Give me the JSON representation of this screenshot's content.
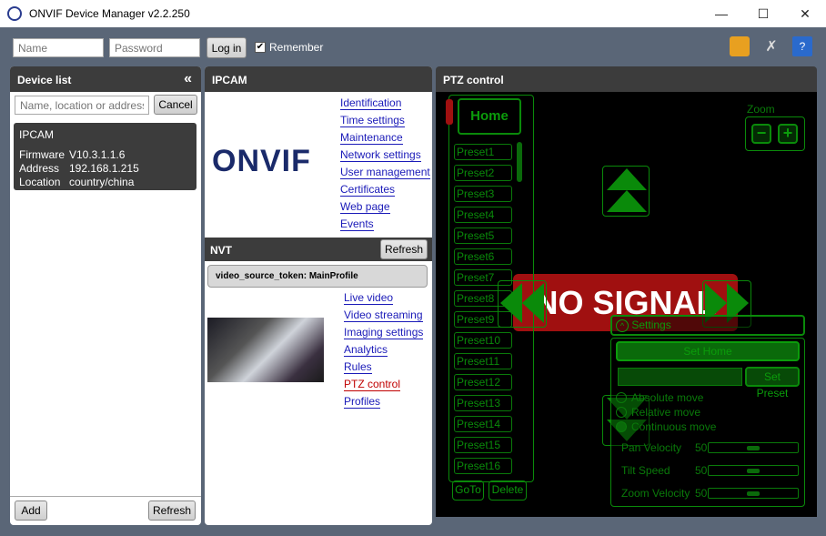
{
  "window": {
    "title": "ONVIF Device Manager v2.2.250",
    "minimize": "—",
    "maximize": "☐",
    "close": "✕"
  },
  "login": {
    "name_placeholder": "Name",
    "password_placeholder": "Password",
    "login_label": "Log in",
    "remember_label": "Remember",
    "remember_checked": true
  },
  "device_list": {
    "title": "Device list",
    "collapse": "«",
    "search_placeholder": "Name, location or address",
    "cancel_label": "Cancel",
    "device": {
      "name": "IPCAM",
      "fields": [
        {
          "k": "Firmware",
          "v": "V10.3.1.1.6"
        },
        {
          "k": "Address",
          "v": "192.168.1.215"
        },
        {
          "k": "Location",
          "v": "country/china"
        }
      ]
    },
    "add_label": "Add",
    "refresh_label": "Refresh"
  },
  "ipcam": {
    "title": "IPCAM",
    "logo_text": "ONVIF",
    "links": [
      "Identification",
      "Time settings",
      "Maintenance",
      "Network settings",
      "User management",
      "Certificates",
      "Web page",
      "Events"
    ]
  },
  "nvt": {
    "title": "NVT",
    "refresh_label": "Refresh",
    "profile": "video_source_token: MainProfile",
    "links": [
      "Live video",
      "Video streaming",
      "Imaging settings",
      "Analytics",
      "Rules",
      "PTZ control",
      "Profiles"
    ],
    "active_link": "PTZ control"
  },
  "ptz": {
    "title": "PTZ control",
    "home_label": "Home",
    "zoom_label": "Zoom",
    "zoom_minus": "−",
    "zoom_plus": "+",
    "presets": [
      "Preset1",
      "Preset2",
      "Preset3",
      "Preset4",
      "Preset5",
      "Preset6",
      "Preset7",
      "Preset8",
      "Preset9",
      "Preset10",
      "Preset11",
      "Preset12",
      "Preset13",
      "Preset14",
      "Preset15",
      "Preset16"
    ],
    "goto_label": "GoTo",
    "delete_label": "Delete",
    "no_signal": "NO SIGNAL",
    "settings": {
      "title": "Settings",
      "set_home": "Set Home",
      "set_preset": "Set Preset",
      "modes": [
        "Absolute move",
        "Relative move",
        "Continuous move"
      ],
      "selected_mode": "Continuous move",
      "sliders": [
        {
          "label": "Pan Velocity",
          "value": "50"
        },
        {
          "label": "Tilt Speed",
          "value": "50"
        },
        {
          "label": "Zoom Velocity",
          "value": "50"
        }
      ]
    }
  },
  "colors": {
    "accent_link": "#1a1ab8",
    "active_link": "#c00000",
    "ptz_green": "#0a8a0a",
    "no_signal_bg": "#a01010"
  }
}
